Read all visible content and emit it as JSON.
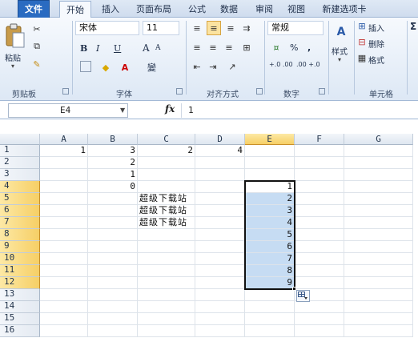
{
  "tabs": [
    "文件",
    "开始",
    "插入",
    "页面布局",
    "公式",
    "数据",
    "审阅",
    "视图",
    "新建选项卡"
  ],
  "ribbon": {
    "clipboard": {
      "paste_label": "粘贴",
      "group_label": "剪贴板"
    },
    "font": {
      "font_name": "宋体",
      "font_size": "11",
      "group_label": "字体",
      "bold": "B",
      "italic": "I",
      "underline": "U",
      "grow": "A",
      "shrink": "A",
      "phonetic": "變"
    },
    "alignment": {
      "group_label": "对齐方式"
    },
    "number": {
      "format": "常规",
      "percent": "%",
      "comma": ",",
      "inc_decimal": "+.0 .00",
      "dec_decimal": ".00 +.0",
      "group_label": "数字"
    },
    "styles": {
      "label": "样式"
    },
    "cells": {
      "insert_label": "插入",
      "delete_label": "删除",
      "format_label": "格式",
      "group_label": "单元格"
    },
    "sigma": "Σ"
  },
  "formula_bar": {
    "name_box": "E4",
    "fx": "fx",
    "content": "1"
  },
  "sheet": {
    "columns": [
      "A",
      "B",
      "C",
      "D",
      "E",
      "F",
      "G"
    ],
    "selected_column": "E",
    "rows": [
      "1",
      "2",
      "3",
      "4",
      "5",
      "6",
      "7",
      "8",
      "9",
      "10",
      "11",
      "12",
      "13",
      "14",
      "15",
      "16"
    ],
    "selected_rows": [
      "4",
      "5",
      "6",
      "7",
      "8",
      "9",
      "10",
      "11",
      "12"
    ],
    "cells": {
      "A1": "1",
      "B1": "3",
      "C1": "2",
      "D1": "4",
      "B2": "2",
      "B3": "1",
      "B4": "0",
      "C5": "超级下载站",
      "C6": "超级下载站",
      "C7": "超级下载站",
      "E4": "1",
      "E5": "2",
      "E6": "3",
      "E7": "4",
      "E8": "5",
      "E9": "6",
      "E10": "7",
      "E11": "8",
      "E12": "9"
    }
  },
  "colors": {
    "file_tab": "#2a6bc1",
    "selection_fill": "#c6dcf3",
    "header_highlight": "#f6cf66"
  }
}
